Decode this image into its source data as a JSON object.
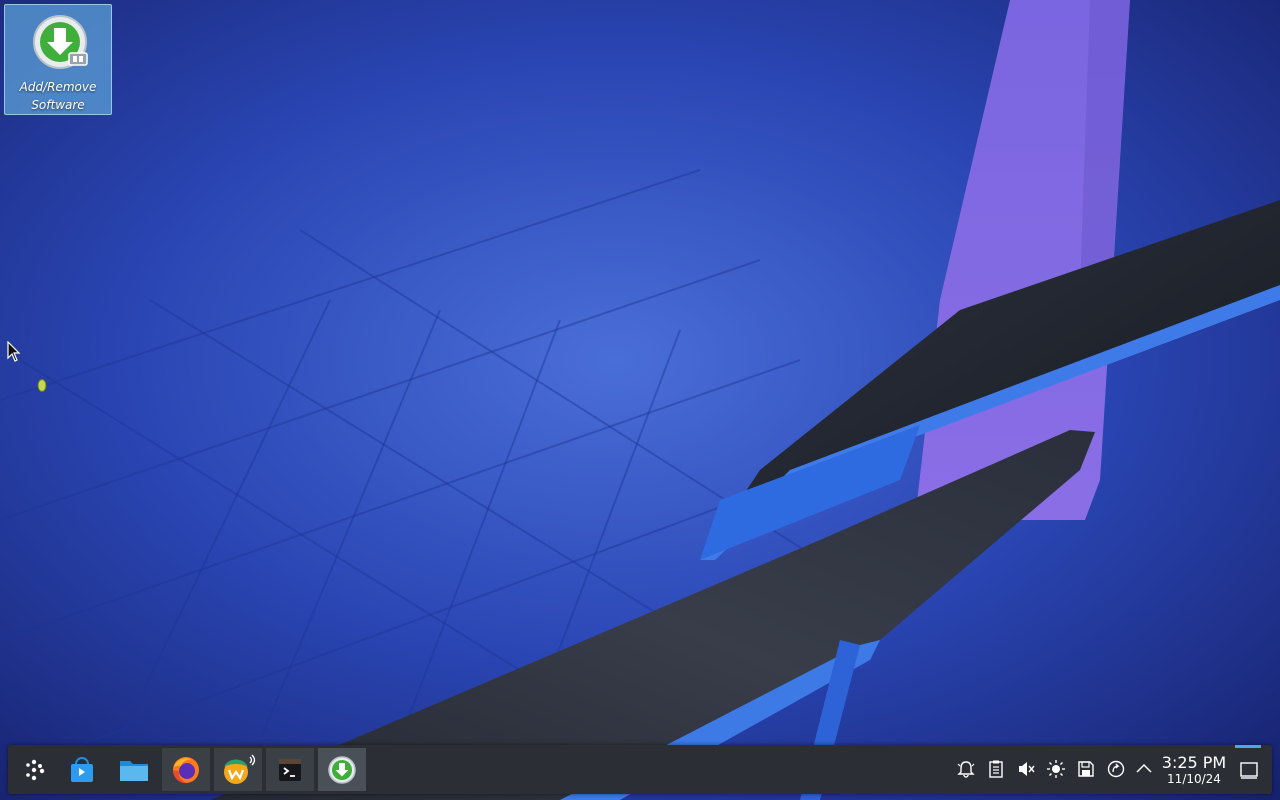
{
  "desktop": {
    "icons": [
      {
        "label": "Add/Remove Software",
        "icon": "software-install-icon"
      }
    ]
  },
  "taskbar": {
    "launcher": {
      "icon": "app-launcher-icon"
    },
    "apps": [
      {
        "name": "Discover",
        "icon": "discover-store-icon",
        "state": "pinned"
      },
      {
        "name": "Files",
        "icon": "folder-icon",
        "state": "pinned"
      },
      {
        "name": "Firefox",
        "icon": "firefox-icon",
        "state": "open"
      },
      {
        "name": "Media player",
        "icon": "media-app-icon",
        "state": "open",
        "audio": true
      },
      {
        "name": "Terminal",
        "icon": "terminal-icon",
        "state": "open"
      },
      {
        "name": "Add/Remove Software",
        "icon": "software-install-icon",
        "state": "active"
      }
    ],
    "tray": [
      {
        "icon": "notifications-icon"
      },
      {
        "icon": "clipboard-icon"
      },
      {
        "icon": "volume-muted-icon"
      },
      {
        "icon": "brightness-icon"
      },
      {
        "icon": "save-icon"
      },
      {
        "icon": "update-icon"
      },
      {
        "icon": "tray-expand-icon"
      }
    ],
    "clock": {
      "time": "3:25 PM",
      "date": "11/10/24"
    }
  },
  "colors": {
    "accent": "#3daee9",
    "panel": "#2b2f35",
    "install_green": "#3fae3a"
  }
}
